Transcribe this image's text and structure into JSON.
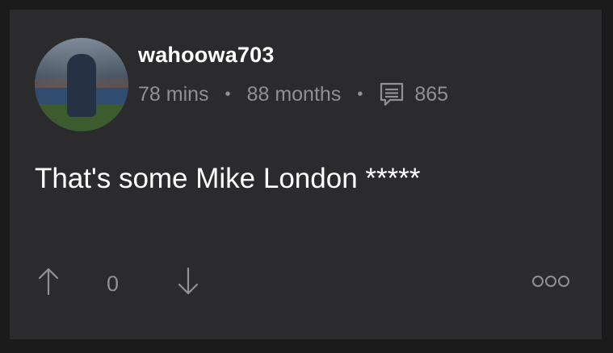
{
  "post": {
    "username": "wahoowa703",
    "time_posted": "78 mins",
    "member_since": "88 months",
    "comment_count": "865",
    "body": "That's some Mike London *****",
    "vote_count": "0"
  },
  "icons": {
    "upvote": "arrow-up-icon",
    "downvote": "arrow-down-icon",
    "comments": "comment-icon",
    "more": "more-options-icon"
  },
  "colors": {
    "background": "#1b1b1c",
    "card": "#2b2a2c",
    "text_primary": "#ffffff",
    "text_secondary": "#8f9197"
  }
}
